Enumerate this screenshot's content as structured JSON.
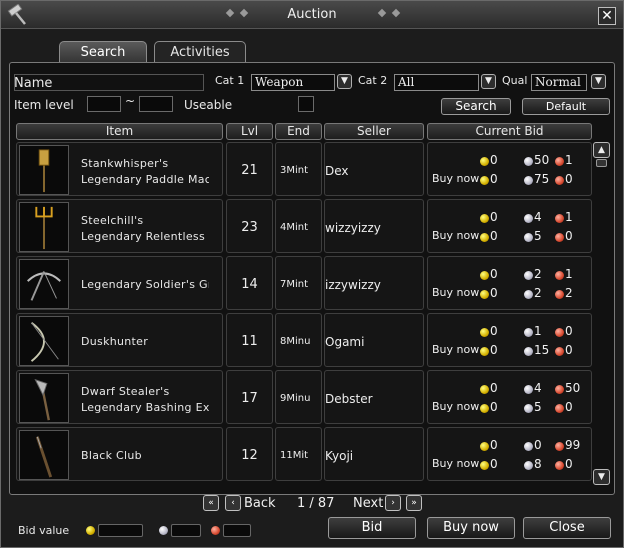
{
  "window": {
    "title": "Auction",
    "close_glyph": "✕"
  },
  "tabs": [
    {
      "label": "Search",
      "active": true
    },
    {
      "label": "Activities",
      "active": false
    }
  ],
  "filters": {
    "name_label": "Name",
    "cat1_label": "Cat 1",
    "cat1_value": "Weapon",
    "cat2_label": "Cat 2",
    "cat2_value": "All",
    "qual_label": "Qual",
    "qual_value": "Normal",
    "item_level_label": "Item level",
    "level_sep": "~",
    "useable_label": "Useable",
    "search_button": "Search",
    "default_button": "Default"
  },
  "columns": [
    "Item",
    "Lvl",
    "End",
    "Seller",
    "Current Bid"
  ],
  "rows": [
    {
      "name1": "Stankwhisper's",
      "name2": "Legendary Paddle Mac",
      "lvl": "21",
      "end": "3Mint",
      "seller": "Dex",
      "bid": [
        "0",
        "50",
        "1"
      ],
      "buy": [
        "0",
        "75",
        "0"
      ],
      "icon": "paddle-mace-icon"
    },
    {
      "name1": "Steelchill's",
      "name2": "Legendary Relentless C",
      "lvl": "23",
      "end": "4Mint",
      "seller": "wizzyizzy",
      "bid": [
        "0",
        "4",
        "1"
      ],
      "buy": [
        "0",
        "5",
        "0"
      ],
      "icon": "trident-icon"
    },
    {
      "name1": "Legendary Soldier's Gre",
      "name2": "",
      "lvl": "14",
      "end": "7Mint",
      "seller": "izzywizzy",
      "bid": [
        "0",
        "2",
        "1"
      ],
      "buy": [
        "0",
        "2",
        "2"
      ],
      "icon": "crossbow-icon"
    },
    {
      "name1": "Duskhunter",
      "name2": "",
      "lvl": "11",
      "end": "8Minu",
      "seller": "Ogami",
      "bid": [
        "0",
        "1",
        "0"
      ],
      "buy": [
        "0",
        "15",
        "0"
      ],
      "icon": "bow-icon"
    },
    {
      "name1": "Dwarf Stealer's",
      "name2": "Legendary Bashing Exe",
      "lvl": "17",
      "end": "9Minu",
      "seller": "Debster",
      "bid": [
        "0",
        "4",
        "50"
      ],
      "buy": [
        "0",
        "5",
        "0"
      ],
      "icon": "axe-icon"
    },
    {
      "name1": "Black Club",
      "name2": "",
      "lvl": "12",
      "end": "11Mit",
      "seller": "Kyoji",
      "bid": [
        "0",
        "0",
        "99"
      ],
      "buy": [
        "0",
        "8",
        "0"
      ],
      "icon": "club-icon"
    }
  ],
  "buy_now_label": "Buy now",
  "pager": {
    "back": "Back",
    "next": "Next",
    "page": "1 / 87"
  },
  "footer": {
    "bid_value_label": "Bid value",
    "bid_button": "Bid",
    "buy_now_button": "Buy now",
    "close_button": "Close"
  }
}
